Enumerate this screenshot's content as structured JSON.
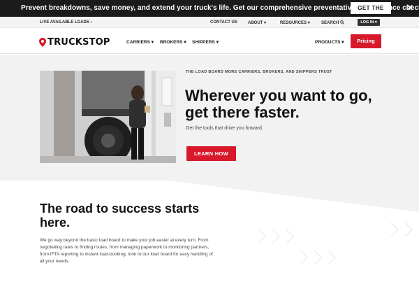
{
  "promo": {
    "text": "Prevent breakdowns, save money, and extend your truck's life. Get our comprehensive preventative maintenance checklist.",
    "button": "GET THE LIST",
    "close_icon": "close-icon"
  },
  "utility": {
    "live_loads": "LIVE AVAILABLE LOADS",
    "contact": "CONTACT US",
    "about": "ABOUT",
    "resources": "RESOURCES",
    "search": "SEARCH",
    "login": "LOG IN",
    "caret": "▾"
  },
  "nav": {
    "logo_text": "TRUCKSTOP",
    "items": [
      "CARRIERS",
      "BROKERS",
      "SHIPPERS"
    ],
    "products": "PRODUCTS",
    "pricing": "Pricing",
    "brand_color": "#d7192b"
  },
  "hero": {
    "kicker": "THE LOAD BOARD MORE CARRIERS, BROKERS, AND SHIPPERS TRUST",
    "title": "Wherever you want to go, get there faster.",
    "subtitle": "Get the tools that drive you forward.",
    "button": "LEARN HOW"
  },
  "section": {
    "title": "The road to success starts here.",
    "body": "We go way beyond the basic load board to make your job easier at every turn. From negotiating rates to finding routes, from managing paperwork to monitoring partners, from IFTA reporting to instant load-booking, look to our load board for easy handling of all your needs."
  }
}
